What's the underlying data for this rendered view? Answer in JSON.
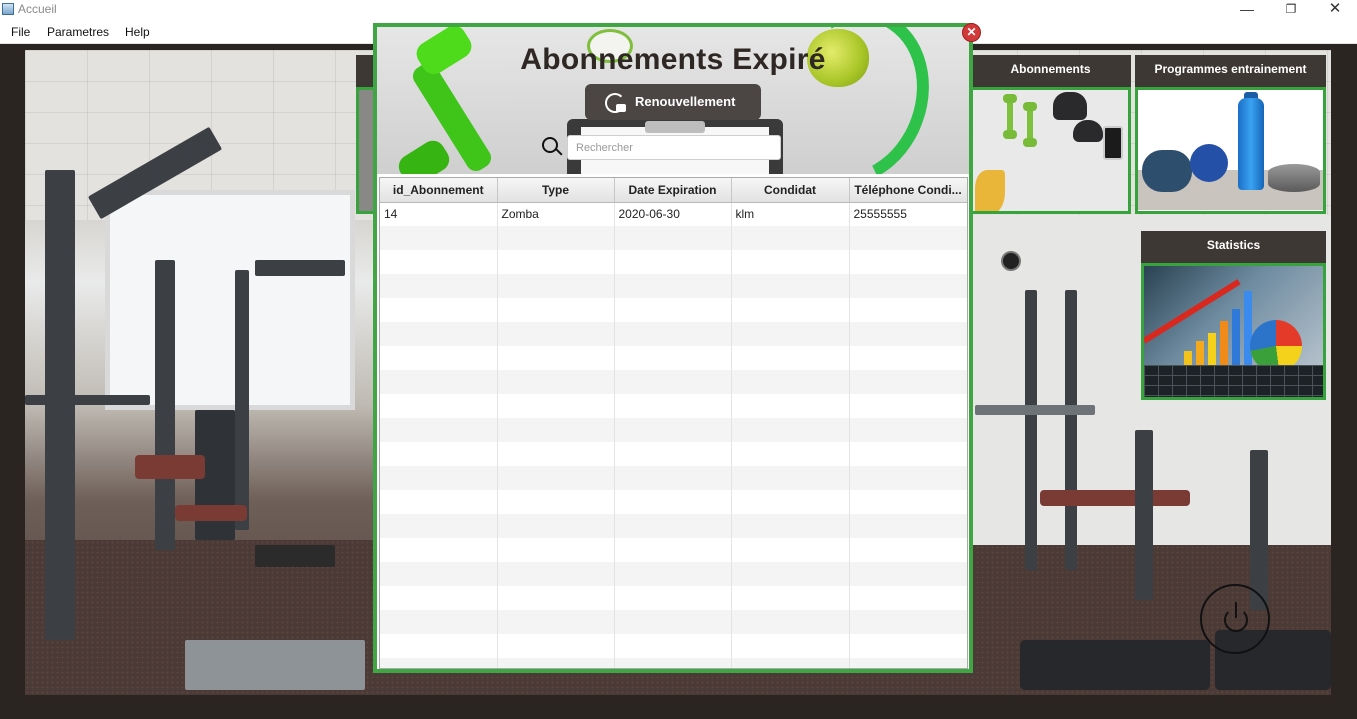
{
  "window": {
    "title": "Accueil",
    "minimize": "—",
    "maximize": "❐",
    "close": "✕"
  },
  "menu": {
    "file": "File",
    "parametres": "Parametres",
    "help": "Help"
  },
  "tiles": {
    "abonnements": "Abonnements",
    "programmes": "Programmes entrainement",
    "statistics": "Statistics"
  },
  "dialog": {
    "title": "Abonnements Expiré",
    "renew_label": "Renouvellement",
    "search_placeholder": "Rechercher",
    "search_value": "",
    "close": "✕",
    "table": {
      "columns": [
        "id_Abonnement",
        "Type",
        "Date Expiration",
        "Condidat",
        "Téléphone Condi..."
      ],
      "rows": [
        [
          "14",
          "Zomba",
          "2020-06-30",
          "klm",
          "25555555"
        ]
      ]
    }
  },
  "colors": {
    "accent_green": "#3ea743",
    "tile_header": "#3e3834",
    "close_red": "#d23a3a"
  }
}
